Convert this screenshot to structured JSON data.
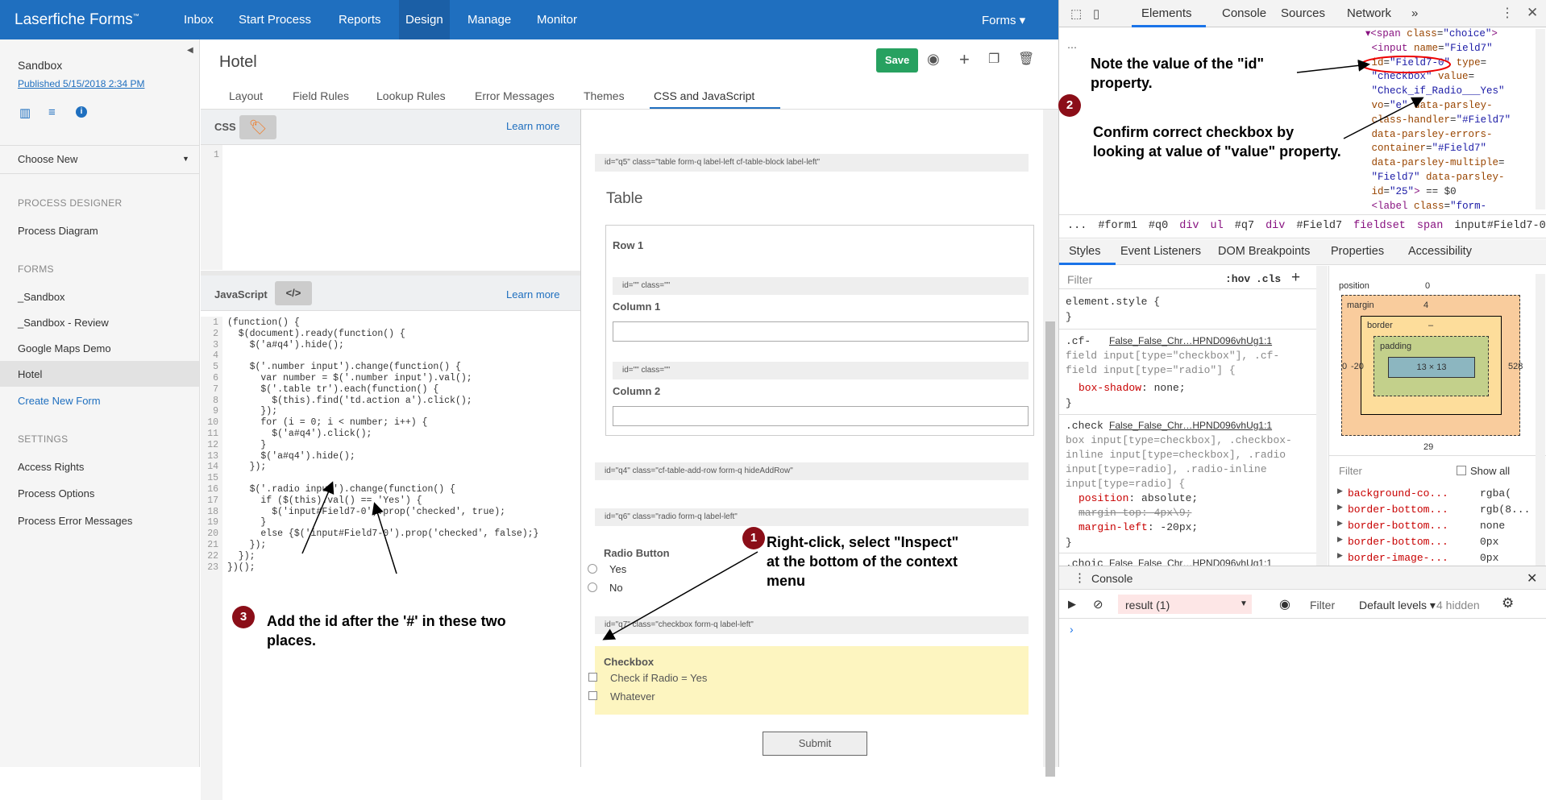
{
  "topnav": {
    "brand": "Laserfiche Forms",
    "tm": "™",
    "items": [
      "Inbox",
      "Start Process",
      "Reports",
      "Design",
      "Manage",
      "Monitor"
    ],
    "right": "Forms"
  },
  "sidebar": {
    "title": "Sandbox",
    "published": "Published 5/15/2018 2:34 PM",
    "choose": "Choose New",
    "sec1": "PROCESS DESIGNER",
    "item1": "Process Diagram",
    "sec2": "FORMS",
    "forms": [
      "_Sandbox",
      "_Sandbox - Review",
      "Google Maps Demo",
      "Hotel"
    ],
    "create": "Create New Form",
    "sec3": "SETTINGS",
    "settings": [
      "Access Rights",
      "Process Options",
      "Process Error Messages"
    ]
  },
  "main": {
    "title": "Hotel",
    "save": "Save",
    "tabs": [
      "Layout",
      "Field Rules",
      "Lookup Rules",
      "Error Messages",
      "Themes",
      "CSS and JavaScript"
    ],
    "css_label": "CSS",
    "js_label": "JavaScript",
    "learn": "Learn more",
    "css_line": "1"
  },
  "js": {
    "lines": [
      "(function() {",
      "  $(document).ready(function() {",
      "    $('a#q4').hide();",
      "",
      "    $('.number input').change(function() {",
      "      var number = $('.number input').val();",
      "      $('.table tr').each(function() {",
      "        $(this).find('td.action a').click();",
      "      });",
      "      for (i = 0; i < number; i++) {",
      "        $('a#q4').click();",
      "      }",
      "      $('a#q4').hide();",
      "    });",
      "",
      "    $('.radio input').change(function() {",
      "      if ($(this).val() == 'Yes') {",
      "        $('input#Field7-0').prop('checked', true);",
      "      }",
      "      else {$('input#Field7-0').prop('checked', false);}",
      "    });",
      "  });",
      "})();"
    ]
  },
  "form": {
    "q5": "id=\"q5\" class=\"table form-q label-left cf-table-block label-left\"",
    "table": "Table",
    "row1": "Row 1",
    "col_meta": "id=\"\" class=\"\"",
    "col1": "Column 1",
    "col2": "Column 2",
    "q4": "id=\"q4\" class=\"cf-table-add-row form-q hideAddRow\"",
    "q6": "id=\"q6\" class=\"radio form-q label-left\"",
    "radio_label": "Radio Button",
    "yes": "Yes",
    "no": "No",
    "q7": "id=\"q7\" class=\"checkbox form-q label-left\"",
    "check_label": "Checkbox",
    "check1": "Check if Radio = Yes",
    "check2": "Whatever",
    "submit": "Submit"
  },
  "annotations": {
    "a1": "Right-click, select \"Inspect\" at the bottom of the context menu",
    "a2a": "Note the value of the \"id\" property.",
    "a2b": "Confirm correct checkbox by looking at value of \"value\" property.",
    "a3": "Add the id after the '#' in these two places.",
    "n1": "1",
    "n2": "2",
    "n3": "3"
  },
  "devtools": {
    "tabs": [
      "Elements",
      "Console",
      "Sources",
      "Network"
    ],
    "more": "»",
    "breadcrumb": [
      "...",
      "#form1",
      "#q0",
      "div",
      "ul",
      "#q7",
      "div",
      "#Field7",
      "fieldset",
      "span",
      "input#Field7-0"
    ],
    "subtabs": [
      "Styles",
      "Event Listeners",
      "DOM Breakpoints",
      "Properties",
      "Accessibility"
    ],
    "filter": "Filter",
    "hov": ":hov",
    "cls": ".cls",
    "console_title": "Console",
    "console_ctx": "result (1)",
    "console_filter": "Filter",
    "levels": "Default levels",
    "hidden": "4 hidden",
    "show_all": "Show all",
    "box": {
      "position_label": "position",
      "position": "0",
      "margin_label": "margin",
      "margin": "4",
      "border_label": "border",
      "padding_label": "padding",
      "content": "13 × 13",
      "left": "0",
      "left2": "-20",
      "right": "528",
      "bottom": "29",
      "dash": "–"
    },
    "computed": [
      [
        "background-co...",
        "rgba("
      ],
      [
        "border-bottom...",
        "rgb(8..."
      ],
      [
        "border-bottom...",
        "none"
      ],
      [
        "border-bottom...",
        "0px"
      ],
      [
        "border-image-...",
        "0px"
      ]
    ],
    "src_link": "False_False_Chr…HPND096vhUg1:1"
  }
}
